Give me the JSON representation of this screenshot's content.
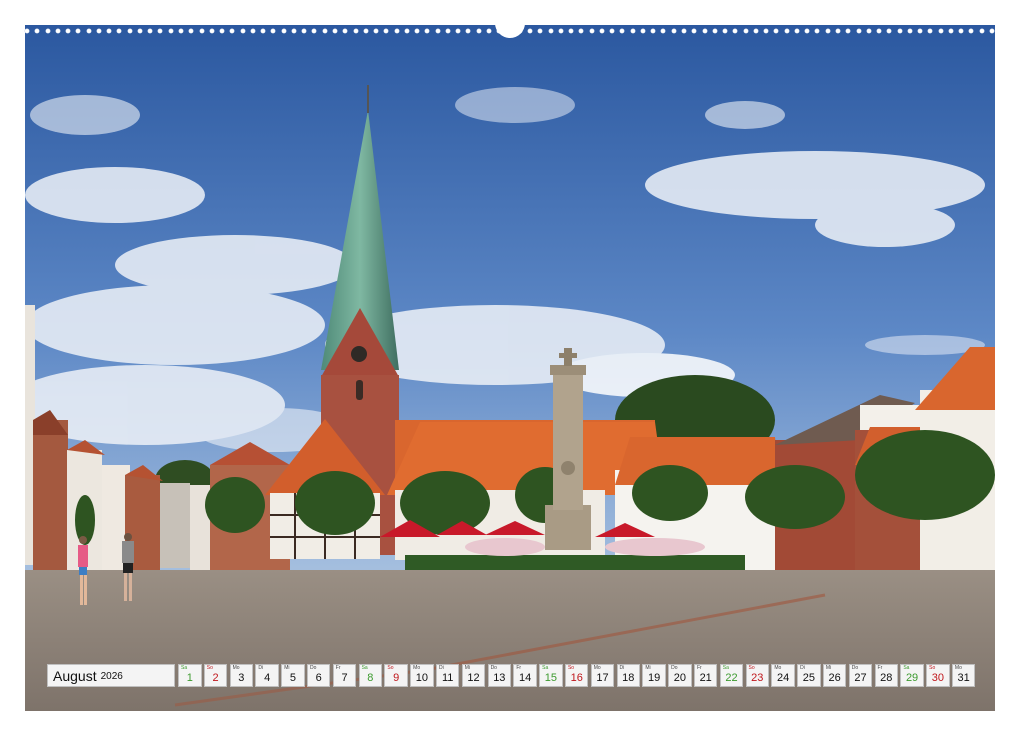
{
  "calendar": {
    "month": "August",
    "year": "2026",
    "days": [
      {
        "abbr": "Sa",
        "num": "1",
        "type": "sat"
      },
      {
        "abbr": "So",
        "num": "2",
        "type": "sun"
      },
      {
        "abbr": "Mo",
        "num": "3",
        "type": "week"
      },
      {
        "abbr": "Di",
        "num": "4",
        "type": "week"
      },
      {
        "abbr": "Mi",
        "num": "5",
        "type": "week"
      },
      {
        "abbr": "Do",
        "num": "6",
        "type": "week"
      },
      {
        "abbr": "Fr",
        "num": "7",
        "type": "week"
      },
      {
        "abbr": "Sa",
        "num": "8",
        "type": "sat"
      },
      {
        "abbr": "So",
        "num": "9",
        "type": "sun"
      },
      {
        "abbr": "Mo",
        "num": "10",
        "type": "week"
      },
      {
        "abbr": "Di",
        "num": "11",
        "type": "week"
      },
      {
        "abbr": "Mi",
        "num": "12",
        "type": "week"
      },
      {
        "abbr": "Do",
        "num": "13",
        "type": "week"
      },
      {
        "abbr": "Fr",
        "num": "14",
        "type": "week"
      },
      {
        "abbr": "Sa",
        "num": "15",
        "type": "sat"
      },
      {
        "abbr": "So",
        "num": "16",
        "type": "sun"
      },
      {
        "abbr": "Mo",
        "num": "17",
        "type": "week"
      },
      {
        "abbr": "Di",
        "num": "18",
        "type": "week"
      },
      {
        "abbr": "Mi",
        "num": "19",
        "type": "week"
      },
      {
        "abbr": "Do",
        "num": "20",
        "type": "week"
      },
      {
        "abbr": "Fr",
        "num": "21",
        "type": "week"
      },
      {
        "abbr": "Sa",
        "num": "22",
        "type": "sat"
      },
      {
        "abbr": "So",
        "num": "23",
        "type": "sun"
      },
      {
        "abbr": "Mo",
        "num": "24",
        "type": "week"
      },
      {
        "abbr": "Di",
        "num": "25",
        "type": "week"
      },
      {
        "abbr": "Mi",
        "num": "26",
        "type": "week"
      },
      {
        "abbr": "Do",
        "num": "27",
        "type": "week"
      },
      {
        "abbr": "Fr",
        "num": "28",
        "type": "week"
      },
      {
        "abbr": "Sa",
        "num": "29",
        "type": "sat"
      },
      {
        "abbr": "So",
        "num": "30",
        "type": "sun"
      },
      {
        "abbr": "Mo",
        "num": "31",
        "type": "week"
      }
    ]
  },
  "colors": {
    "saturday": "#3c9a2e",
    "sunday": "#c0171c",
    "sky_top": "#2f5fa6",
    "sky_bottom": "#7fa6d4",
    "roof": "#d9662e",
    "spire": "#5e9a86",
    "brick": "#b6563a",
    "pavement": "#8f8479"
  },
  "photo": {
    "scene": "market-square-church-photo"
  }
}
